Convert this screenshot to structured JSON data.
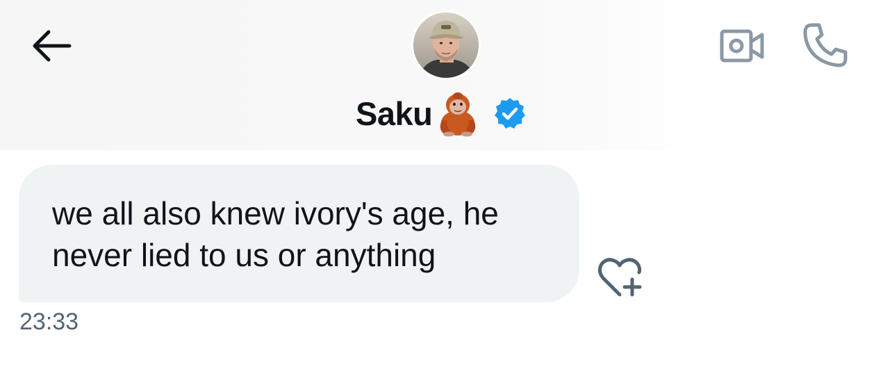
{
  "header": {
    "contact_name": "Saku",
    "name_emoji": "orangutan-emoji",
    "verified": true,
    "icons": {
      "back": "arrow-left-icon",
      "video": "video-camera-icon",
      "call": "phone-icon",
      "verified": "verified-badge-icon"
    },
    "colors": {
      "verified": "#1d9bf0",
      "icon_gray": "#8b98a5"
    }
  },
  "messages": [
    {
      "text": "we all also knew ivory's age, he never lied to us or anything",
      "time": "23:33",
      "bubble_color": "#eff3f4"
    }
  ],
  "react_icon": "heart-plus-icon"
}
